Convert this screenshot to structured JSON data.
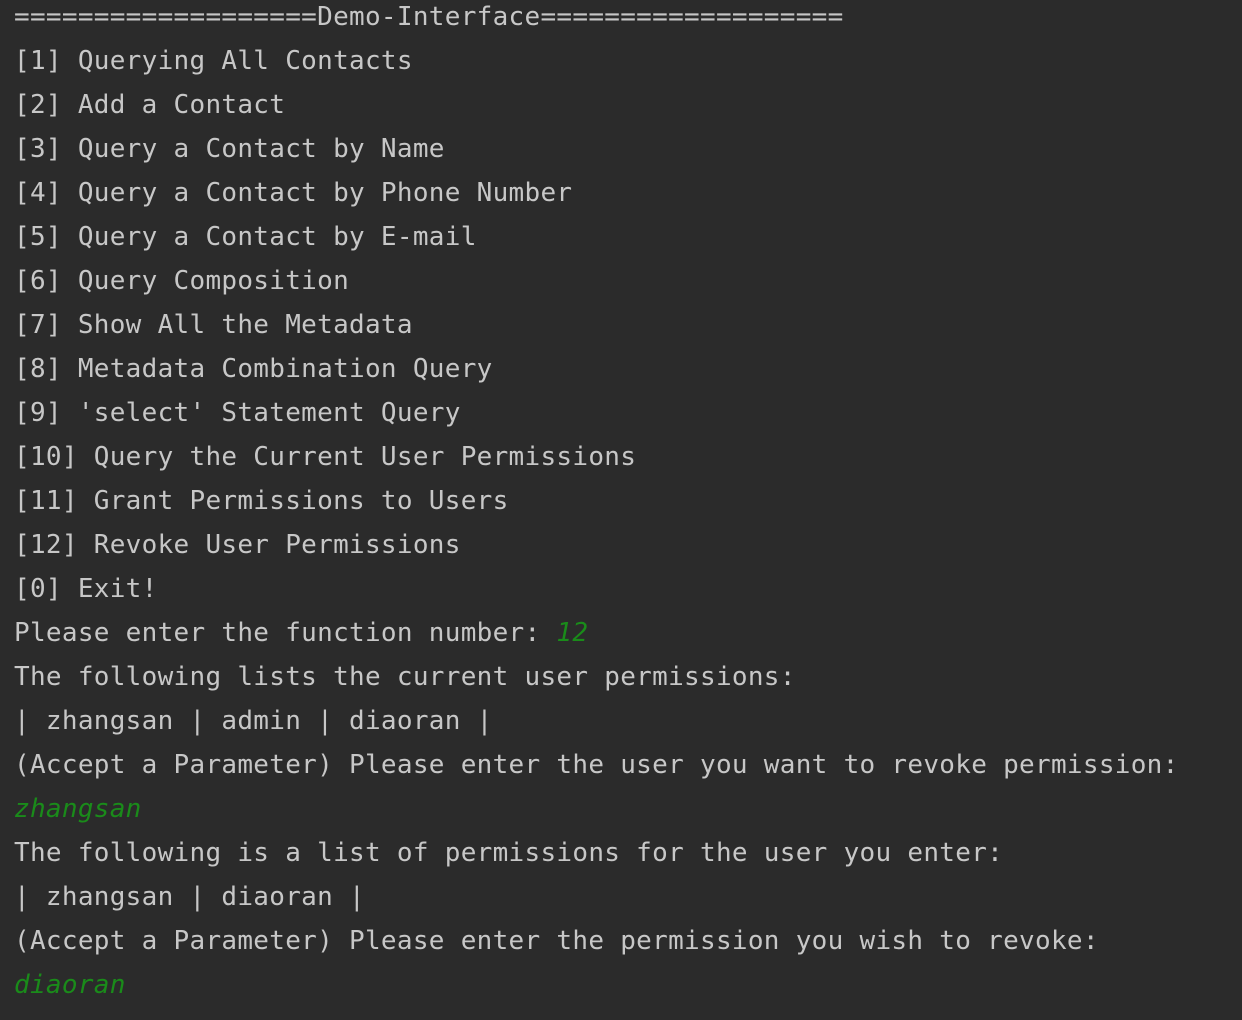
{
  "console": {
    "banner": "===================Demo-Interface===================",
    "menu": [
      "[1] Querying All Contacts",
      "[2] Add a Contact",
      "[3] Query a Contact by Name",
      "[4] Query a Contact by Phone Number",
      "[5] Query a Contact by E-mail",
      "[6] Query Composition",
      "[7] Show All the Metadata",
      "[8] Metadata Combination Query",
      "[9] 'select' Statement Query",
      "[10] Query the Current User Permissions",
      "[11] Grant Permissions to Users",
      "[12] Revoke User Permissions",
      "[0] Exit!"
    ],
    "prompt_function": "Please enter the function number: ",
    "input_function": "12",
    "list_heading": "The following lists the current user permissions:",
    "users_row": "| zhangsan | admin | diaoran |",
    "prompt_user": "(Accept a Parameter) Please enter the user you want to revoke permission:",
    "input_user": "zhangsan",
    "perm_heading": "The following is a list of permissions for the user you enter:",
    "perms_row": "| zhangsan | diaoran |",
    "prompt_perm": "(Accept a Parameter) Please enter the permission you wish to revoke:",
    "input_perm": "diaoran"
  },
  "colors": {
    "background": "#2b2b2b",
    "text": "#c7c7c7",
    "user_input": "#1a8b1a"
  }
}
